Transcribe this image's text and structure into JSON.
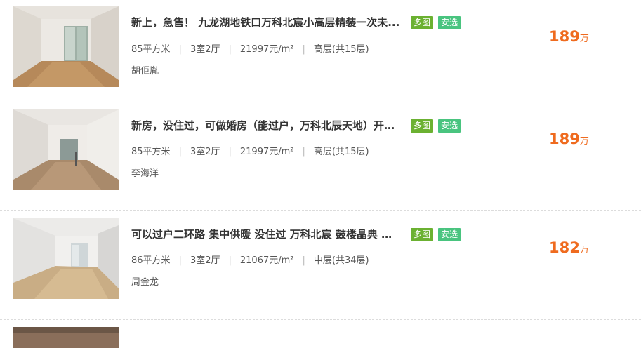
{
  "listings": [
    {
      "title": "新上，急售！ 九龙湖地铁口万科北宸小高层精装一次未...",
      "tags": [
        "多图",
        "安选"
      ],
      "area": "85平方米",
      "layout": "3室2厅",
      "unit_price": "21997元/m²",
      "floor": "高层(共15层)",
      "agent": "胡佢胤",
      "price": "189",
      "price_unit": "万"
    },
    {
      "title": "新房，没住过，可做婚房（能过户，万科北辰天地）开发...",
      "tags": [
        "多图",
        "安选"
      ],
      "area": "85平方米",
      "layout": "3室2厅",
      "unit_price": "21997元/m²",
      "floor": "高层(共15层)",
      "agent": "李海洋",
      "price": "189",
      "price_unit": "万"
    },
    {
      "title": "可以过户二环路 集中供暖 没住过 万科北宸 鼓楼晶典 米...",
      "tags": [
        "多图",
        "安选"
      ],
      "area": "86平方米",
      "layout": "3室2厅",
      "unit_price": "21067元/m²",
      "floor": "中层(共34层)",
      "agent": "周金龙",
      "price": "182",
      "price_unit": "万"
    }
  ],
  "colors": {
    "price": "#ef6b1f",
    "tag_duotu": "#6bb131",
    "tag_anxuan": "#49c47f"
  }
}
